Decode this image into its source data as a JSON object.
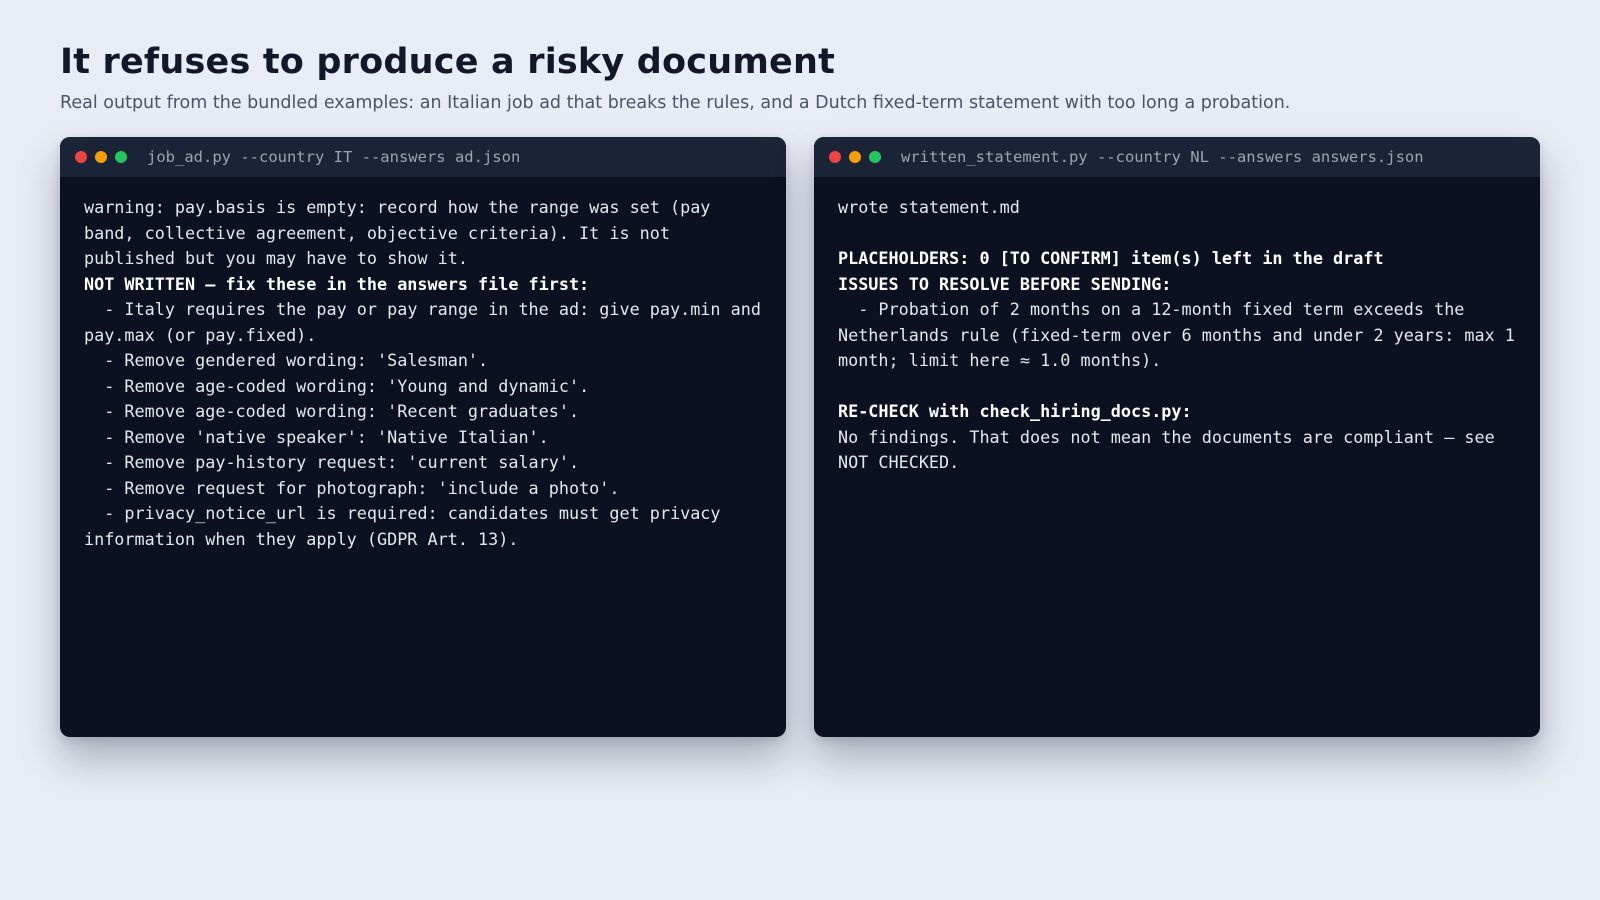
{
  "page": {
    "title": "It refuses to produce a risky document",
    "subtitle": "Real output from the bundled examples: an Italian job ad that breaks the rules, and a Dutch fixed-term statement with too long a probation."
  },
  "colors": {
    "background": "#e8ecf5",
    "terminal_bg": "#0b1120",
    "titlebar_bg": "#1b2436",
    "dot_red": "#ef4444",
    "dot_yellow": "#f59e0b",
    "dot_green": "#22c55e"
  },
  "terminals": [
    {
      "command": "job_ad.py --country IT --answers ad.json",
      "lines": [
        {
          "text": "warning: pay.basis is empty: record how the range was set (pay band, collective agreement, objective criteria). It is not published but you may have to show it.",
          "bold": false
        },
        {
          "text": "NOT WRITTEN — fix these in the answers file first:",
          "bold": true
        },
        {
          "text": "  - Italy requires the pay or pay range in the ad: give pay.min and pay.max (or pay.fixed).",
          "bold": false
        },
        {
          "text": "  - Remove gendered wording: 'Salesman'.",
          "bold": false
        },
        {
          "text": "  - Remove age-coded wording: 'Young and dynamic'.",
          "bold": false
        },
        {
          "text": "  - Remove age-coded wording: 'Recent graduates'.",
          "bold": false
        },
        {
          "text": "  - Remove 'native speaker': 'Native Italian'.",
          "bold": false
        },
        {
          "text": "  - Remove pay-history request: 'current salary'.",
          "bold": false
        },
        {
          "text": "  - Remove request for photograph: 'include a photo'.",
          "bold": false
        },
        {
          "text": "  - privacy_notice_url is required: candidates must get privacy information when they apply (GDPR Art. 13).",
          "bold": false
        }
      ]
    },
    {
      "command": "written_statement.py --country NL --answers answers.json",
      "lines": [
        {
          "text": "wrote statement.md",
          "bold": false
        },
        {
          "text": "",
          "bold": false
        },
        {
          "text": "PLACEHOLDERS: 0 [TO CONFIRM] item(s) left in the draft",
          "bold": true
        },
        {
          "text": "ISSUES TO RESOLVE BEFORE SENDING:",
          "bold": true
        },
        {
          "text": "  - Probation of 2 months on a 12-month fixed term exceeds the Netherlands rule (fixed-term over 6 months and under 2 years: max 1 month; limit here ≈ 1.0 months).",
          "bold": false
        },
        {
          "text": "",
          "bold": false
        },
        {
          "text": "RE-CHECK with check_hiring_docs.py:",
          "bold": true
        },
        {
          "text": "No findings. That does not mean the documents are compliant — see NOT CHECKED.",
          "bold": false
        }
      ]
    }
  ]
}
